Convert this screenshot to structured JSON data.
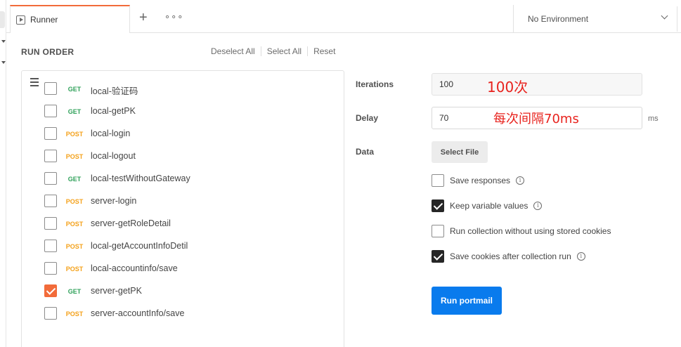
{
  "window": {
    "tab_title": "Runner",
    "new_tab_label": "+",
    "more_label": "∘∘∘"
  },
  "environment": {
    "selected": "No Environment"
  },
  "run_order": {
    "title": "RUN ORDER",
    "deselect_all": "Deselect All",
    "select_all": "Select All",
    "reset": "Reset",
    "requests": [
      {
        "method": "GET",
        "name": "local-验证码",
        "checked": false
      },
      {
        "method": "GET",
        "name": "local-getPK",
        "checked": false
      },
      {
        "method": "POST",
        "name": "local-login",
        "checked": false
      },
      {
        "method": "POST",
        "name": "local-logout",
        "checked": false
      },
      {
        "method": "GET",
        "name": "local-testWithoutGateway",
        "checked": false
      },
      {
        "method": "POST",
        "name": "server-login",
        "checked": false
      },
      {
        "method": "POST",
        "name": "server-getRoleDetail",
        "checked": false
      },
      {
        "method": "POST",
        "name": "local-getAccountInfoDetil",
        "checked": false
      },
      {
        "method": "POST",
        "name": "local-accountinfo/save",
        "checked": false
      },
      {
        "method": "GET",
        "name": "server-getPK",
        "checked": true
      },
      {
        "method": "POST",
        "name": "server-accountInfo/save",
        "checked": false
      }
    ]
  },
  "settings": {
    "iterations_label": "Iterations",
    "iterations_value": "100",
    "iterations_annotation": "100次",
    "delay_label": "Delay",
    "delay_value": "70",
    "delay_unit": "ms",
    "delay_annotation": "每次间隔70ms",
    "data_label": "Data",
    "select_file_label": "Select File",
    "options": [
      {
        "label": "Save responses",
        "checked": false,
        "info": true
      },
      {
        "label": "Keep variable values",
        "checked": true,
        "info": true
      },
      {
        "label": "Run collection without using stored cookies",
        "checked": false,
        "info": false
      },
      {
        "label": "Save cookies after collection run",
        "checked": true,
        "info": true
      }
    ],
    "run_button_label": "Run portmail"
  },
  "colors": {
    "accent_orange": "#f26b3a",
    "get_green": "#2fa15a",
    "post_orange": "#f4a11a",
    "run_blue": "#097bed",
    "annotation_red": "#e8231e"
  },
  "icons": [
    "runner-icon",
    "plus-icon",
    "more-icon",
    "chevron-down-icon",
    "drag-handle-icon",
    "info-icon"
  ]
}
